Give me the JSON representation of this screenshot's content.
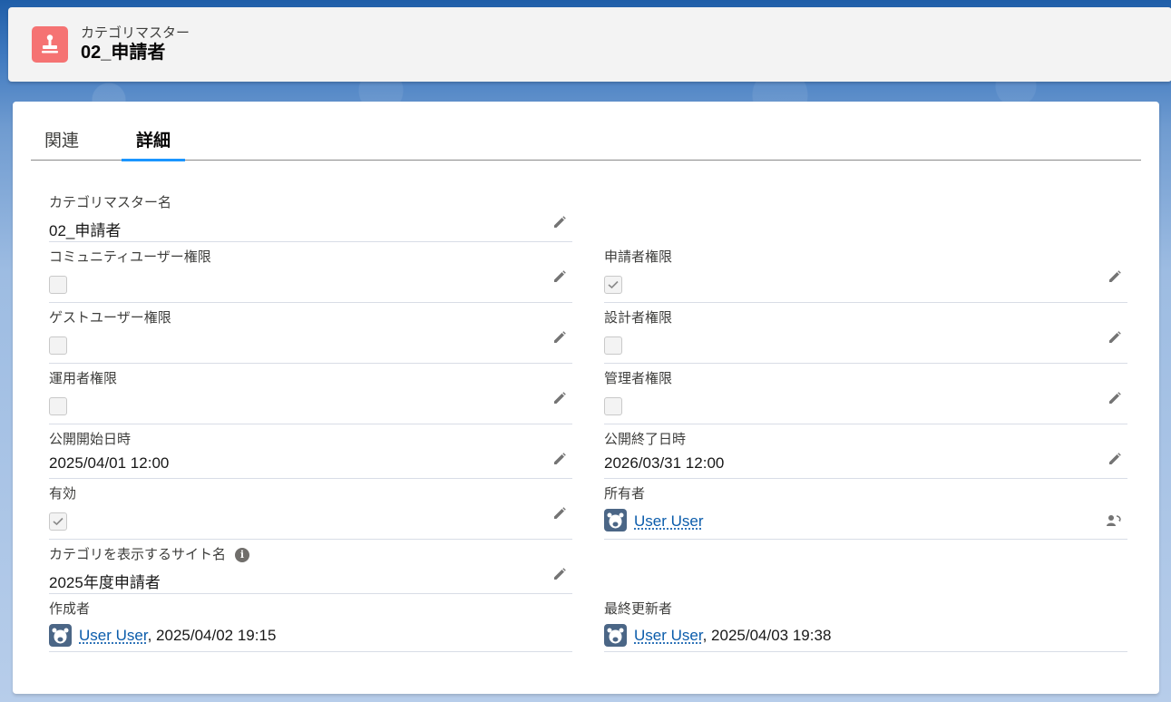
{
  "header": {
    "object_label": "カテゴリマスター",
    "record_name": "02_申請者",
    "icon": "category-stamp-icon",
    "icon_color": "#f57373"
  },
  "tabs": [
    {
      "label": "関連",
      "active": false
    },
    {
      "label": "詳細",
      "active": true
    }
  ],
  "fields": {
    "name": {
      "label": "カテゴリマスター名",
      "value": "02_申請者"
    },
    "community_user": {
      "label": "コミュニティユーザー権限",
      "checked": false
    },
    "applicant": {
      "label": "申請者権限",
      "checked": true
    },
    "guest_user": {
      "label": "ゲストユーザー権限",
      "checked": false
    },
    "designer": {
      "label": "設計者権限",
      "checked": false
    },
    "operator": {
      "label": "運用者権限",
      "checked": false
    },
    "admin": {
      "label": "管理者権限",
      "checked": false
    },
    "publish_start": {
      "label": "公開開始日時",
      "value": "2025/04/01 12:00"
    },
    "publish_end": {
      "label": "公開終了日時",
      "value": "2026/03/31 12:00"
    },
    "active": {
      "label": "有効",
      "checked": true
    },
    "owner": {
      "label": "所有者",
      "user": "User User"
    },
    "site_name": {
      "label": "カテゴリを表示するサイト名",
      "value": "2025年度申請者"
    },
    "created_by": {
      "label": "作成者",
      "user": "User User",
      "separator": ",",
      "datetime": "2025/04/02 19:15"
    },
    "modified_by": {
      "label": "最終更新者",
      "user": "User User",
      "separator": ",",
      "datetime": "2025/04/03 19:38"
    }
  },
  "colors": {
    "link": "#0b5cab",
    "tab_indicator": "#1b96ff",
    "avatar_bg": "#4b6686"
  }
}
